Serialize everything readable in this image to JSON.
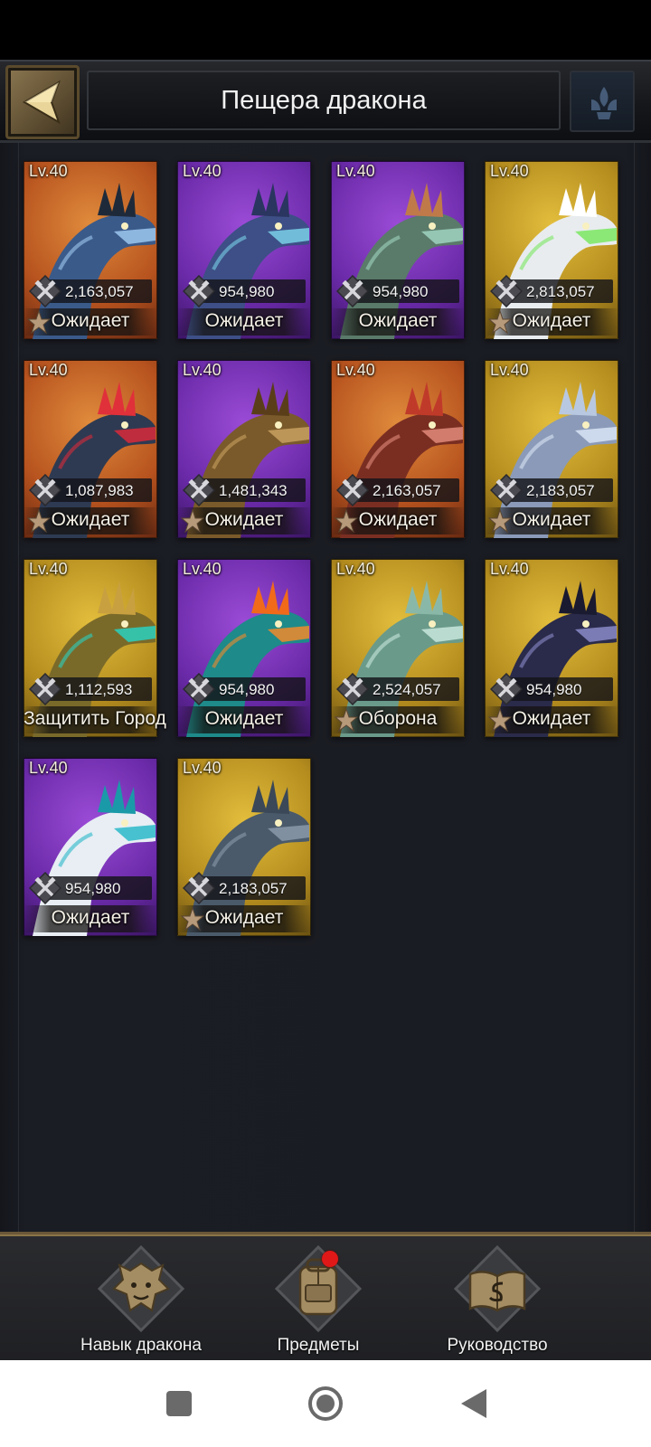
{
  "header": {
    "title": "Пещера дракона",
    "back_icon": "chevron-left-icon",
    "crest_icon": "fleur-crest-icon"
  },
  "dragons": [
    {
      "level": "Lv.40",
      "power": "2,163,057",
      "status": "Ожидает",
      "starred": true,
      "bg": "orange",
      "body": "#3a5a8a",
      "accent": "#9ec8ee",
      "crest": "#1e2a3a"
    },
    {
      "level": "Lv.40",
      "power": "954,980",
      "status": "Ожидает",
      "starred": false,
      "bg": "purple",
      "body": "#3d4f86",
      "accent": "#7ad0e8",
      "crest": "#2a3560"
    },
    {
      "level": "Lv.40",
      "power": "954,980",
      "status": "Ожидает",
      "starred": false,
      "bg": "purple",
      "body": "#5a7a6a",
      "accent": "#9fd4c0",
      "crest": "#c07a4a"
    },
    {
      "level": "Lv.40",
      "power": "2,813,057",
      "status": "Ожидает",
      "starred": true,
      "bg": "gold",
      "body": "#e8ecef",
      "accent": "#7ae860",
      "crest": "#ffffff"
    },
    {
      "level": "Lv.40",
      "power": "1,087,983",
      "status": "Ожидает",
      "starred": true,
      "bg": "orange",
      "body": "#2e3a52",
      "accent": "#d82a3a",
      "crest": "#e0303a"
    },
    {
      "level": "Lv.40",
      "power": "1,481,343",
      "status": "Ожидает",
      "starred": true,
      "bg": "purple",
      "body": "#7a5a2a",
      "accent": "#c8a060",
      "crest": "#5a3e1a"
    },
    {
      "level": "Lv.40",
      "power": "2,163,057",
      "status": "Ожидает",
      "starred": true,
      "bg": "orange",
      "body": "#7a2e22",
      "accent": "#e08a7a",
      "crest": "#c03a2a"
    },
    {
      "level": "Lv.40",
      "power": "2,183,057",
      "status": "Ожидает",
      "starred": true,
      "bg": "gold",
      "body": "#8a9ab8",
      "accent": "#d8e4f4",
      "crest": "#b8c8e0"
    },
    {
      "level": "Lv.40",
      "power": "1,112,593",
      "status": "Защитить Город",
      "starred": false,
      "bg": "gold",
      "body": "#7a6a2a",
      "accent": "#2ad0c0",
      "crest": "#c8a040"
    },
    {
      "level": "Lv.40",
      "power": "954,980",
      "status": "Ожидает",
      "starred": false,
      "bg": "purple",
      "body": "#1e8a8a",
      "accent": "#f08a2a",
      "crest": "#f06a1a"
    },
    {
      "level": "Lv.40",
      "power": "2,524,057",
      "status": "Оборона",
      "starred": true,
      "bg": "gold",
      "body": "#6a9a8a",
      "accent": "#c8e8dc",
      "crest": "#8ab8a8"
    },
    {
      "level": "Lv.40",
      "power": "954,980",
      "status": "Ожидает",
      "starred": true,
      "bg": "gold",
      "body": "#2a2a4a",
      "accent": "#8a8ac8",
      "crest": "#1a1a30"
    },
    {
      "level": "Lv.40",
      "power": "954,980",
      "status": "Ожидает",
      "starred": false,
      "bg": "purple",
      "body": "#e8eef4",
      "accent": "#2ab8c8",
      "crest": "#1a9aa8"
    },
    {
      "level": "Lv.40",
      "power": "2,183,057",
      "status": "Ожидает",
      "starred": true,
      "bg": "gold",
      "body": "#4a5a6a",
      "accent": "#8a9aaa",
      "crest": "#3a4858"
    }
  ],
  "footer": {
    "skill_label": "Навык дракона",
    "items_label": "Предметы",
    "guide_label": "Руководство",
    "items_has_notification": true
  },
  "colors": {
    "gold_accent": "#6a5738",
    "notification": "#e01818"
  }
}
